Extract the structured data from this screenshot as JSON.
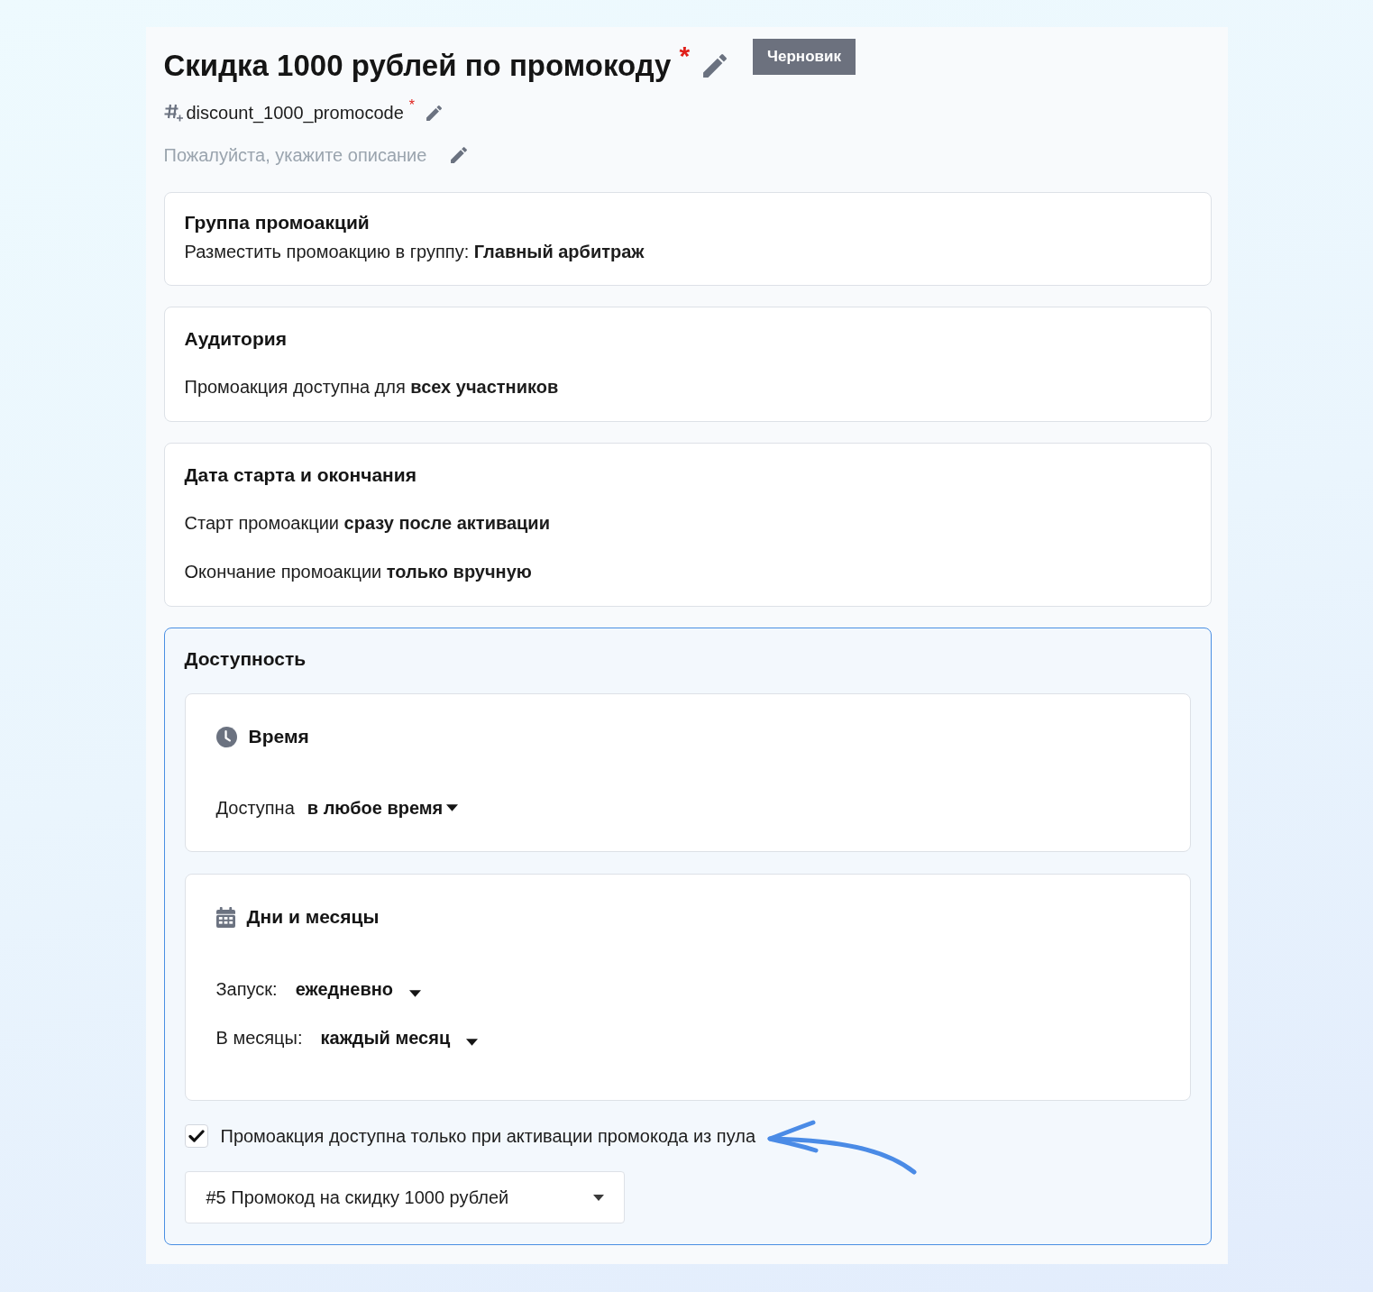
{
  "header": {
    "title": "Скидка 1000 рублей по промокоду",
    "title_required": "*",
    "status": "Черновик",
    "code": "discount_1000_promocode",
    "code_required": "*",
    "description": {
      "placeholder": "Пожалуйста, укажите описание"
    }
  },
  "sections": [
    {
      "kind": "compact",
      "highlighted": false,
      "title": "Группа промоакций",
      "lines": [
        "Разместить промоакцию в группу: **Главный арбитраж**"
      ]
    },
    {
      "kind": "spaced",
      "highlighted": false,
      "title": "Аудитория",
      "lines": [
        "Промоакция доступна для **всех участников**"
      ]
    },
    {
      "kind": "spaced",
      "highlighted": false,
      "title": "Дата старта и окончания",
      "lines": [
        "Старт промоакции **сразу после активации**",
        "Окончание промоакции **только вручную**"
      ]
    },
    {
      "kind": "availability",
      "highlighted": true,
      "title": "Доступность",
      "blocks": [
        {
          "kind": "time",
          "title": "Время",
          "rows": [
            {
              "label": "Доступна",
              "value": "в любое время"
            }
          ]
        },
        {
          "kind": "days",
          "title": "Дни и месяцы",
          "rows": [
            {
              "label": "Запуск:",
              "value": "ежедневно"
            },
            {
              "label": "В месяцы:",
              "value": "каждый месяц"
            }
          ]
        }
      ],
      "pool_only": {
        "label": "Промоакция доступна только при активации промокода из пула",
        "checked": true
      },
      "pool": {
        "value": "#5 Промокод на скидку 1000 рублей"
      }
    }
  ]
}
